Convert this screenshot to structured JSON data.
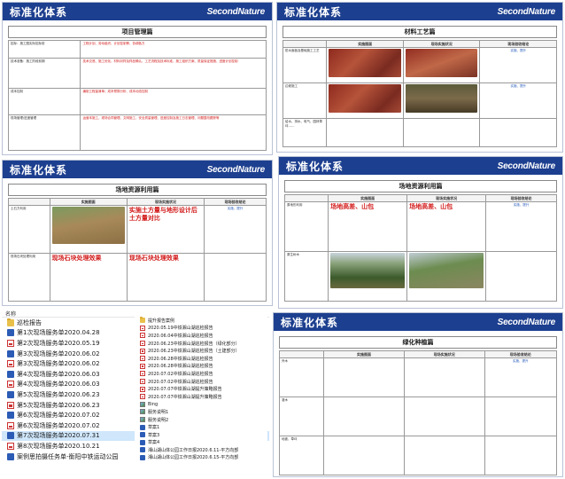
{
  "brand": {
    "title": "标准化体系",
    "logo": "SecondNature"
  },
  "panels": {
    "project_mgmt": {
      "section_title": "项目管理篇",
      "rows": [
        {
          "label": "招标：施工图实际招标前",
          "text": "工程计划、劳动组织、计划控制等、协调各方"
        },
        {
          "label": "技术准备：施工阶段前期",
          "text": "技术交底、施工优化、材料封样及样品确认、工艺流程及技术标准、施工组织方案、质量保证措施、进度计划控制"
        },
        {
          "label": "成本控制",
          "text": "编制工程量清单；成本预算分析、成本动态控制"
        },
        {
          "label": "现场管理/进度管理",
          "text": "运营本施工，现场合同管理、文明施工、安全质量管理、进度控制及施工日志管理、问题整改跟踪等"
        }
      ]
    },
    "material": {
      "section_title": "材料工艺篇",
      "cols": [
        "实施图面",
        "现场实施状况",
        "现场验收结论"
      ],
      "rows": [
        {
          "label": "防水面板及基础施工工艺"
        },
        {
          "label": "边坡施工"
        },
        {
          "label": "给水、排水、电气、园林草坪……"
        }
      ],
      "status": "实施、提升"
    },
    "site_res1": {
      "section_title": "场地资源利用篇",
      "cols": [
        "实施图面",
        "现场实施状况",
        "现场验收结论"
      ],
      "rows": [
        {
          "label": "土石方利用",
          "note": "实施土方量与地形设计后土方量对比"
        },
        {
          "label": "现场石块处理利用",
          "note_a": "现场石块处理效果",
          "note_b": "现场石块处理效果"
        }
      ],
      "status": "实施、提升"
    },
    "site_res2": {
      "section_title": "场地资源利用篇",
      "cols": [
        "实施图面",
        "现场实施状况",
        "现场验收结论"
      ],
      "rows": [
        {
          "label": "原地形利用",
          "note_a": "场地高差、山包",
          "note_b": "场地高差、山包"
        },
        {
          "label": "原生树木"
        }
      ],
      "status": "实施、提升"
    },
    "greening": {
      "section_title": "绿化种植篇",
      "cols": [
        "实施图面",
        "现场实施状况",
        "现场验收结论"
      ],
      "rows": [
        {
          "label": "乔木"
        },
        {
          "label": "灌木"
        },
        {
          "label": "地被、草坪"
        }
      ],
      "status": "实施、提升"
    }
  },
  "explorer": {
    "column_header": "名称",
    "left_items": [
      "巡检报告",
      "第1次现场服务单2020.04.28",
      "第2次现场服务单2020.05.19",
      "第3次现场服务单2020.06.02",
      "第3次现场服务单2020.06.02",
      "第4次现场服务单2020.06.03",
      "第4次现场服务单2020.06.03",
      "第5次现场服务单2020.06.23",
      "第5次现场服务单2020.06.23",
      "第6次现场服务单2020.07.02",
      "第6次现场服务单2020.07.02",
      "第7次现场服务单2020.07.31",
      "第8次现场服务单2020.10.21",
      "案例思拍摄任务单-衡阳中铁运动公园"
    ],
    "right_items": [
      "提升报告案例",
      "2020.05.19中铁湘山湖巡检报告",
      "2020.06.04中铁湘山湖巡检报告",
      "2020.06.23中铁湘山湖巡检报告（绿化部分）",
      "2020.06.23中铁湘山湖巡检报告（土建部分）",
      "2020.06.28中铁湘山湖巡检报告",
      "2020.06.28中铁湘山湖巡检报告",
      "2020.07.02中铁湘山湖巡检报告",
      "2020.07.02中铁湘山湖巡检报告",
      "2020.07.07中铁湘山湖提升策略报告",
      "2020.07.07中铁湘山湖提升策略报告",
      "Bing",
      "服务说明1",
      "服务说明2",
      "草案1",
      "草案3",
      "草案4",
      "湘山湖山体公园工作日报2020.6.11-平方向部",
      "湘山湖山体公园工作日报2020.6.15-平方向部"
    ]
  }
}
